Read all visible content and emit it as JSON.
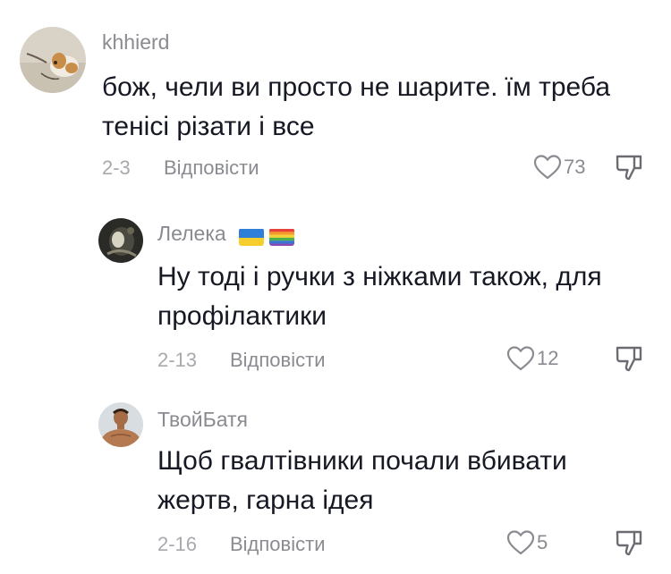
{
  "comments": [
    {
      "username": "khhierd",
      "text": "бож, чели ви просто не шарите. їм треба тенісі різати і все",
      "date": "2-3",
      "reply_label": "Відповісти",
      "likes": "73"
    },
    {
      "username": "Лелека",
      "flags": [
        "ukraine-flag",
        "rainbow-flag"
      ],
      "text": "Ну тоді і ручки з ніжками також, для профілактики",
      "date": "2-13",
      "reply_label": "Відповісти",
      "likes": "12"
    },
    {
      "username": "ТвойБатя",
      "text": "Щоб гвалтівники почали вбивати жертв, гарна ідея",
      "date": "2-16",
      "reply_label": "Відповісти",
      "likes": "5"
    }
  ]
}
